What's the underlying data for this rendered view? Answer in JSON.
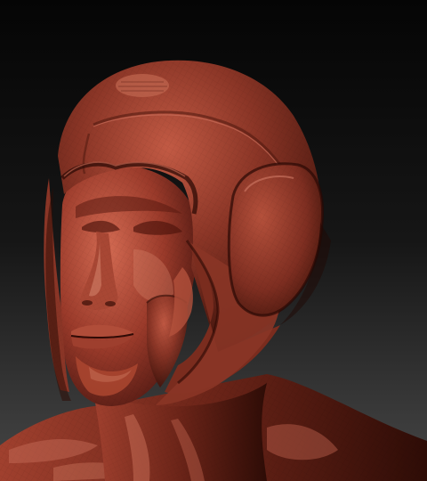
{
  "scene": {
    "subject": "helmet-bust-sculpt",
    "background_top": "#050505",
    "background_bottom": "#474747",
    "material_base": "#8a3526",
    "material_highlight": "#c25a44",
    "material_shadow": "#3a1009",
    "skin_base": "#9a3a2a",
    "skin_highlight": "#d36a52"
  }
}
